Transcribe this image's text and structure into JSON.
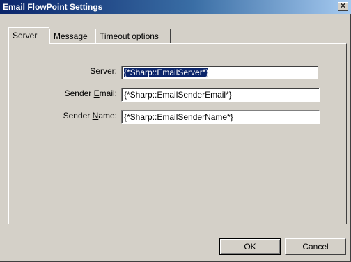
{
  "window": {
    "title": "Email FlowPoint Settings",
    "close_glyph": "✕"
  },
  "tabs": [
    {
      "label": "Server",
      "active": true
    },
    {
      "label": "Message",
      "active": false
    },
    {
      "label": "Timeout options",
      "active": false
    }
  ],
  "fields": {
    "server": {
      "label_before": "",
      "label_mnemonic": "S",
      "label_after": "erver:",
      "value": "{*Sharp::EmailServer*}"
    },
    "sender_email": {
      "label_before": "Sender ",
      "label_mnemonic": "E",
      "label_after": "mail:",
      "value": "{*Sharp::EmailSenderEmail*}"
    },
    "sender_name": {
      "label_before": "Sender ",
      "label_mnemonic": "N",
      "label_after": "ame:",
      "value": "{*Sharp::EmailSenderName*}"
    }
  },
  "buttons": {
    "ok_label": "OK",
    "cancel_label": "Cancel"
  },
  "colors": {
    "titlebar_start": "#0a246a",
    "titlebar_end": "#a6caf0",
    "face": "#d4d0c8",
    "selection": "#0a246a"
  }
}
